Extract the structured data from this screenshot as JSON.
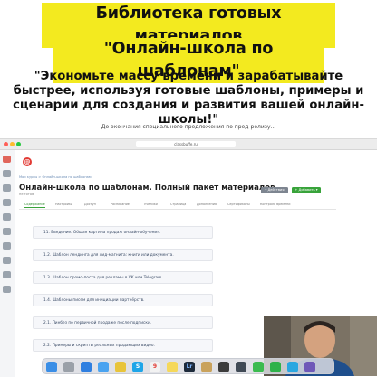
{
  "headline": {
    "line1": "Библиотека готовых материалов",
    "line2": "\"Онлайн-школа по шаблонам\"",
    "subhead": "\"Экономьте массу времени и зарабатывайте быстрее, используя готовые шаблоны, примеры и сценарии для создания и развития вашей онлайн-школы!\"",
    "countdown": "До окончания специального предложения по пред-релизу..."
  },
  "browser": {
    "url": "classbuffe.ru"
  },
  "page": {
    "breadcrumb": "Мои курсы > Онлайн-школа по шаблонам",
    "title": "Онлайн-школа по шаблонам. Полный пакет материалов.",
    "subtitle": "не готов",
    "action_primary": "▾ Действия",
    "action_secondary": "+ Добавить ▾",
    "tabs": [
      "Содержание",
      "Настройки",
      "Доступ",
      "Расписание",
      "Ученики",
      "Страница",
      "Дополнения",
      "Сертификаты",
      "Контроль времени"
    ]
  },
  "lessons": [
    "11. Введение. Общая картина продаж онлайн-обучения.",
    "1.2. Шаблон лендинга для лид-магнита: книги или документа.",
    "1.3. Шаблон промо-поста для рекламы в VK или Telegram.",
    "1.4. Шаблоны писем для инициации партнёрств.",
    "2.1. Линбез по первичной продаже после подписки.",
    "2.2. Примеры и скрипты реальных продающих видео."
  ],
  "colors": {
    "highlight": "#f3ea1f",
    "accent_green": "#38a33a",
    "logo_red": "#e23b35"
  },
  "icons": {
    "dock": [
      "finder-icon",
      "launchpad-icon",
      "safari-icon",
      "mail-icon",
      "chrome-icon",
      "skype-icon",
      "calendar-icon",
      "notes-icon",
      "lightroom-icon",
      "photos-icon",
      "photoshop-icon",
      "quicktime-icon",
      "whatsapp-icon",
      "evernote-icon",
      "telegram-icon",
      "app-icon"
    ]
  }
}
